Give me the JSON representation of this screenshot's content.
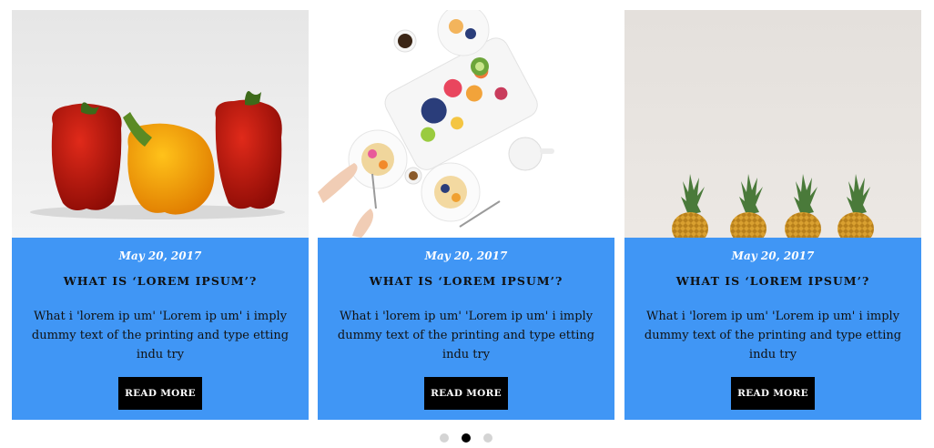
{
  "cards": [
    {
      "image": "red-yellow-bell-peppers",
      "date": "May 20, 2017",
      "title": "WHAT IS ‘LOREM IPSUM’?",
      "excerpt": "What i 'lorem ip um' 'Lorem ip um' i imply dummy text of the printing and type etting indu try",
      "button": "READ MORE"
    },
    {
      "image": "fruit-breakfast-table",
      "date": "May 20, 2017",
      "title": "WHAT IS ‘LOREM IPSUM’?",
      "excerpt": "What i 'lorem ip um' 'Lorem ip um' i imply dummy text of the printing and type etting indu try",
      "button": "READ MORE"
    },
    {
      "image": "four-pineapples",
      "date": "May 20, 2017",
      "title": "WHAT IS ‘LOREM IPSUM’?",
      "excerpt": "What i 'lorem ip um' 'Lorem ip um' i imply dummy text of the printing and type etting indu try",
      "button": "READ MORE"
    }
  ],
  "pagination": {
    "count": 3,
    "active": 2
  },
  "colors": {
    "card_bg": "#4096f5",
    "button_bg": "#000000",
    "dot_active": "#000000",
    "dot_inactive": "#d4d4d4"
  }
}
